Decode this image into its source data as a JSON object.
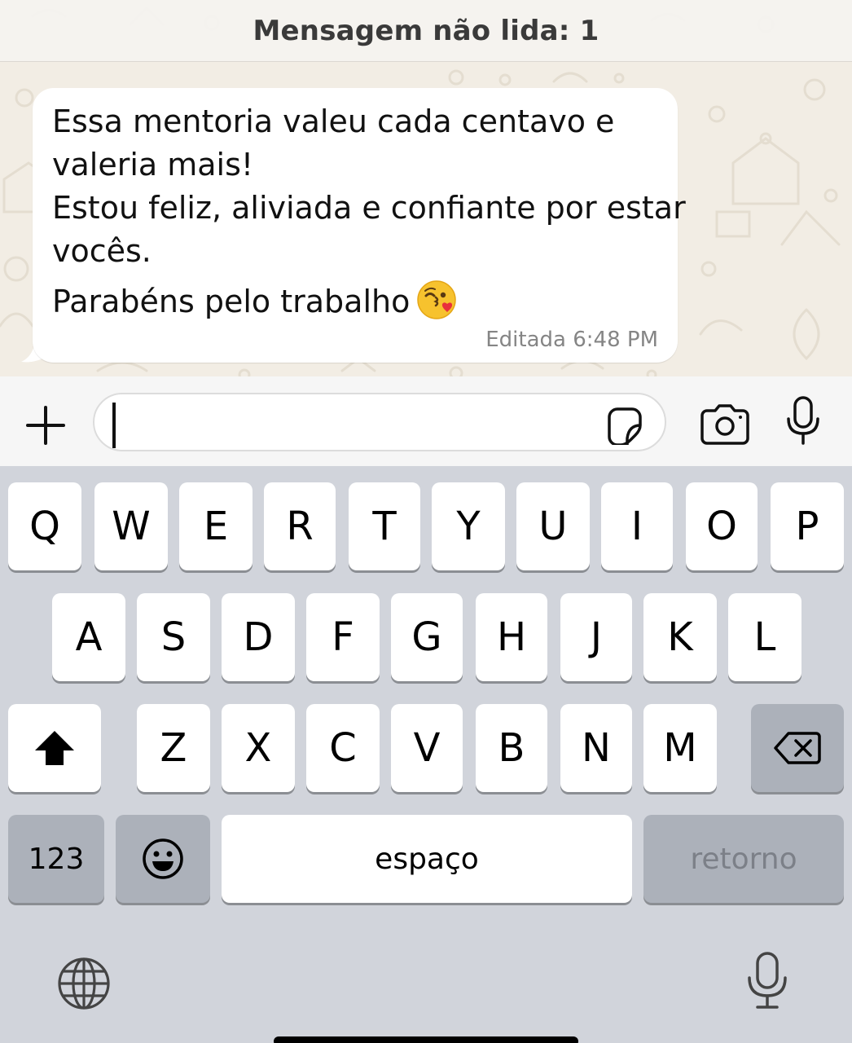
{
  "banner": {
    "unread_label": "Mensagem não lida: 1"
  },
  "message": {
    "lines": [
      "Essa mentoria valeu cada centavo e",
      "valeria mais!",
      "Estou feliz, aliviada e confiante por estar",
      "vocês.",
      "Parabéns pelo trabalho"
    ],
    "emoji": "face-throwing-a-kiss",
    "status": "Editada",
    "time": "6:48 PM"
  },
  "composer": {
    "value": "",
    "icons": [
      "plus-icon",
      "sticker-icon",
      "camera-icon",
      "microphone-icon"
    ]
  },
  "keyboard": {
    "row1": [
      "Q",
      "W",
      "E",
      "R",
      "T",
      "Y",
      "U",
      "I",
      "O",
      "P"
    ],
    "row2": [
      "A",
      "S",
      "D",
      "F",
      "G",
      "H",
      "J",
      "K",
      "L"
    ],
    "row3": [
      "Z",
      "X",
      "C",
      "V",
      "B",
      "N",
      "M"
    ],
    "numbers_label": "123",
    "space_label": "espaço",
    "return_label": "retorno",
    "icons": [
      "shift-icon",
      "backspace-icon",
      "emoji-icon",
      "globe-icon",
      "dictation-icon"
    ]
  },
  "colors": {
    "chat_background": "#f2ede4",
    "bubble": "#ffffff",
    "keyboard_background": "#d1d4db",
    "key": "#ffffff",
    "function_key": "#acb1ba"
  }
}
